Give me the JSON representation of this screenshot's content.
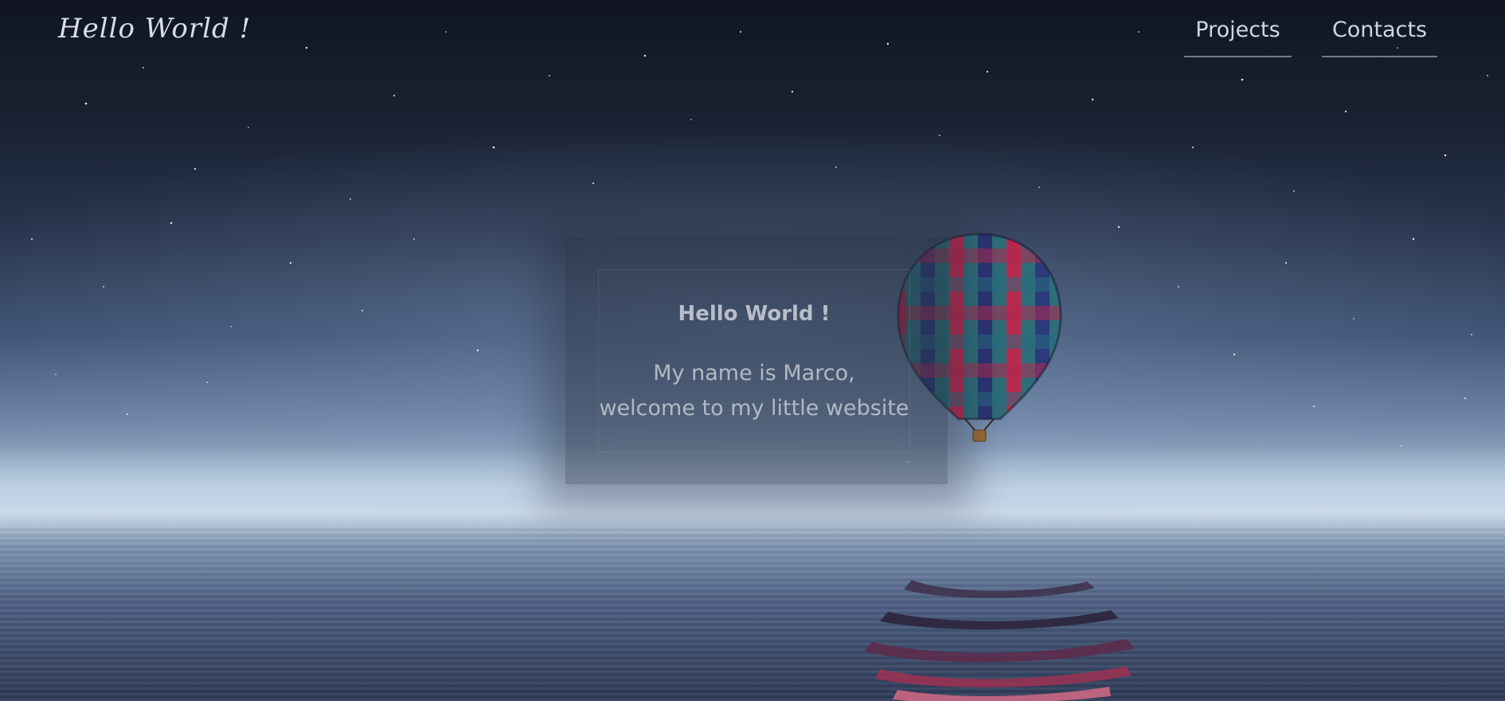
{
  "brand": {
    "title": "Hello World !"
  },
  "nav": {
    "items": [
      {
        "label": "Projects"
      },
      {
        "label": "Contacts"
      }
    ]
  },
  "hero": {
    "title": "Hello World !",
    "lines": [
      "My name is Marco,",
      "welcome to my little website"
    ]
  },
  "colors": {
    "sky_top": "#111521",
    "horizon": "#c7d7e7",
    "text": "#b8bec9",
    "balloon_red": "#b62b4f",
    "balloon_teal": "#2f7683",
    "balloon_navy": "#2a3473"
  },
  "icons": [
    "hot-air-balloon-image"
  ]
}
